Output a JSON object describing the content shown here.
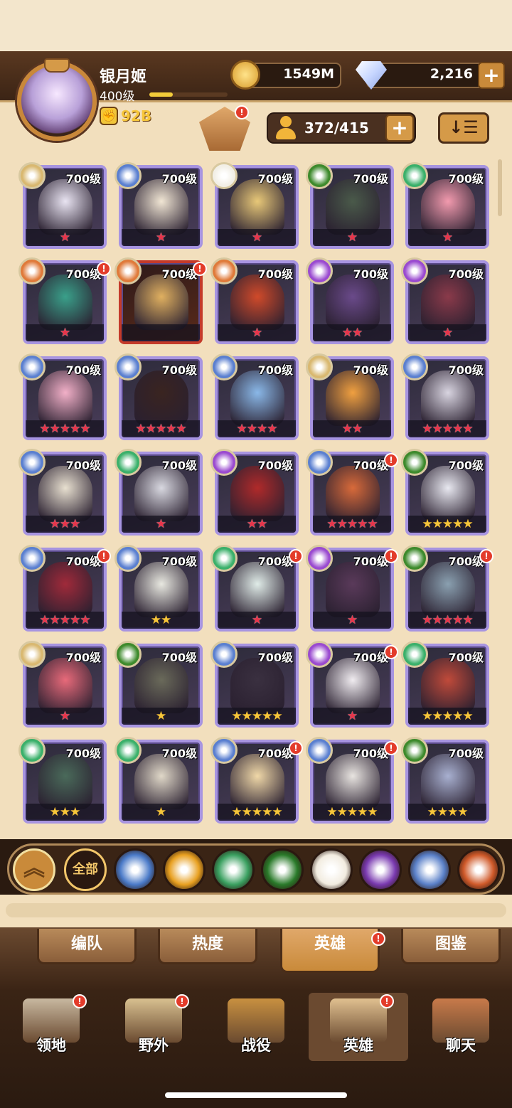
{
  "player": {
    "name": "银月姬",
    "level": "400级",
    "power": "92B",
    "xp_progress": 0.3
  },
  "currency": {
    "gold": "1549M",
    "gems": "2,216",
    "plus": "+"
  },
  "toolbar": {
    "camp_badge": "!",
    "roster": "372/415",
    "roster_plus": "+",
    "sort_icon": "↓☰"
  },
  "heroes": [
    {
      "level": "700级",
      "stars": "★",
      "star_color": "red",
      "faction_color": "#d9b870",
      "portrait": "#e9e4f2",
      "alert": false
    },
    {
      "level": "700级",
      "stars": "★",
      "star_color": "red",
      "faction_color": "#5a7fd0",
      "portrait": "#f1e6d4",
      "alert": false
    },
    {
      "level": "700级",
      "stars": "★",
      "star_color": "red",
      "faction_color": "#f2efe6",
      "portrait": "#e8c878",
      "alert": false
    },
    {
      "level": "700级",
      "stars": "★",
      "star_color": "red",
      "faction_color": "#3d8a2c",
      "portrait": "#4a5a4a",
      "alert": false
    },
    {
      "level": "700级",
      "stars": "★",
      "star_color": "red",
      "faction_color": "#3ab06a",
      "portrait": "#f29aae",
      "alert": false
    },
    {
      "level": "700级",
      "stars": "★",
      "star_color": "red",
      "faction_color": "#e07a3a",
      "portrait": "#3aa08a",
      "alert": true
    },
    {
      "level": "700级",
      "stars": "",
      "star_color": "red",
      "faction_color": "#e07a3a",
      "portrait": "#e0b060",
      "alert": true,
      "red": true
    },
    {
      "level": "700级",
      "stars": "★",
      "star_color": "red",
      "faction_color": "#e07a3a",
      "portrait": "#d04a2a",
      "alert": false
    },
    {
      "level": "700级",
      "stars": "★★",
      "star_color": "red",
      "faction_color": "#9a4ad0",
      "portrait": "#6a4a8a",
      "alert": false
    },
    {
      "level": "700级",
      "stars": "★",
      "star_color": "red",
      "faction_color": "#9a4ad0",
      "portrait": "#8a3a4a",
      "alert": false
    },
    {
      "level": "700级",
      "stars": "★★★★★",
      "star_color": "red",
      "faction_color": "#5a7fd0",
      "portrait": "#f2b0c8",
      "alert": false
    },
    {
      "level": "700级",
      "stars": "★★★★★",
      "star_color": "red",
      "faction_color": "#5a7fd0",
      "portrait": "#3a2420",
      "alert": false
    },
    {
      "level": "700级",
      "stars": "★★★★",
      "star_color": "red",
      "faction_color": "#5a7fd0",
      "portrait": "#8ab8e8",
      "alert": false
    },
    {
      "level": "700级",
      "stars": "★★",
      "star_color": "red",
      "faction_color": "#d9b870",
      "portrait": "#f0a040",
      "alert": false
    },
    {
      "level": "700级",
      "stars": "★★★★★",
      "star_color": "red",
      "faction_color": "#5a7fd0",
      "portrait": "#d8d4e0",
      "alert": false
    },
    {
      "level": "700级",
      "stars": "★★★",
      "star_color": "red",
      "faction_color": "#5a7fd0",
      "portrait": "#e8e0d0",
      "alert": false
    },
    {
      "level": "700级",
      "stars": "★",
      "star_color": "red",
      "faction_color": "#3ab06a",
      "portrait": "#d8d8e0",
      "alert": false
    },
    {
      "level": "700级",
      "stars": "★★",
      "star_color": "red",
      "faction_color": "#9a4ad0",
      "portrait": "#b02a2a",
      "alert": false
    },
    {
      "level": "700级",
      "stars": "★★★★★",
      "star_color": "red",
      "faction_color": "#5a7fd0",
      "portrait": "#d86a3a",
      "alert": true
    },
    {
      "level": "700级",
      "stars": "★★★★★",
      "star_color": "gold",
      "faction_color": "#3d8a2c",
      "portrait": "#e8e8f0",
      "alert": false
    },
    {
      "level": "700级",
      "stars": "★★★★★",
      "star_color": "red",
      "faction_color": "#5a7fd0",
      "portrait": "#a02a3a",
      "alert": true
    },
    {
      "level": "700级",
      "stars": "★★",
      "star_color": "gold",
      "faction_color": "#5a7fd0",
      "portrait": "#e8e8e0",
      "alert": false
    },
    {
      "level": "700级",
      "stars": "★",
      "star_color": "red",
      "faction_color": "#3ab06a",
      "portrait": "#e0ece8",
      "alert": true
    },
    {
      "level": "700级",
      "stars": "★",
      "star_color": "red",
      "faction_color": "#9a4ad0",
      "portrait": "#5a3a5a",
      "alert": true
    },
    {
      "level": "700级",
      "stars": "★★★★★",
      "star_color": "red",
      "faction_color": "#3d8a2c",
      "portrait": "#8aa0b0",
      "alert": true
    },
    {
      "level": "700级",
      "stars": "★",
      "star_color": "red",
      "faction_color": "#d9b870",
      "portrait": "#e86a7a",
      "alert": false
    },
    {
      "level": "700级",
      "stars": "★",
      "star_color": "gold",
      "faction_color": "#3d8a2c",
      "portrait": "#6a6a5a",
      "alert": false
    },
    {
      "level": "700级",
      "stars": "★★★★★",
      "star_color": "gold",
      "faction_color": "#5a7fd0",
      "portrait": "#3a3040",
      "alert": false
    },
    {
      "level": "700级",
      "stars": "★",
      "star_color": "red",
      "faction_color": "#9a4ad0",
      "portrait": "#f0ecf0",
      "alert": true
    },
    {
      "level": "700级",
      "stars": "★★★★★",
      "star_color": "gold",
      "faction_color": "#3ab06a",
      "portrait": "#c04a3a",
      "alert": false
    },
    {
      "level": "700级",
      "stars": "★★★",
      "star_color": "gold",
      "faction_color": "#3ab06a",
      "portrait": "#4a6a5a",
      "alert": false
    },
    {
      "level": "700级",
      "stars": "★",
      "star_color": "gold",
      "faction_color": "#3ab06a",
      "portrait": "#e0d8c8",
      "alert": false
    },
    {
      "level": "700级",
      "stars": "★★★★★",
      "star_color": "gold",
      "faction_color": "#5a7fd0",
      "portrait": "#f0d8a8",
      "alert": true
    },
    {
      "level": "700级",
      "stars": "★★★★★",
      "star_color": "gold",
      "faction_color": "#5a7fd0",
      "portrait": "#e8e4e0",
      "alert": true
    },
    {
      "level": "700级",
      "stars": "★★★★",
      "star_color": "gold",
      "faction_color": "#3d8a2c",
      "portrait": "#a8b0d0",
      "alert": false
    }
  ],
  "filters": {
    "all_label": "全部",
    "factions": [
      {
        "name": "lightbearer",
        "color": "#4a7ac8"
      },
      {
        "name": "mauler",
        "color": "#e8a020"
      },
      {
        "name": "wilder",
        "color": "#3aa060"
      },
      {
        "name": "graveborn",
        "color": "#2a7a2a"
      },
      {
        "name": "celestial",
        "color": "#f2ece0"
      },
      {
        "name": "hypogean",
        "color": "#7a3ab0"
      },
      {
        "name": "dimensional",
        "color": "#5a80c8"
      },
      {
        "name": "flame",
        "color": "#d05a2a"
      }
    ]
  },
  "tabs": [
    "编队",
    "热度",
    "英雄",
    "图鉴"
  ],
  "tab_alert": "!",
  "nav": [
    {
      "label": "领地",
      "alert": true,
      "icon_color": "#c8b8a0"
    },
    {
      "label": "野外",
      "alert": true,
      "icon_color": "#d8c090"
    },
    {
      "label": "战役",
      "alert": false,
      "icon_color": "#c89040"
    },
    {
      "label": "英雄",
      "alert": true,
      "icon_color": "#e0c090"
    },
    {
      "label": "聊天",
      "alert": false,
      "icon_color": "#c87a4a"
    }
  ]
}
